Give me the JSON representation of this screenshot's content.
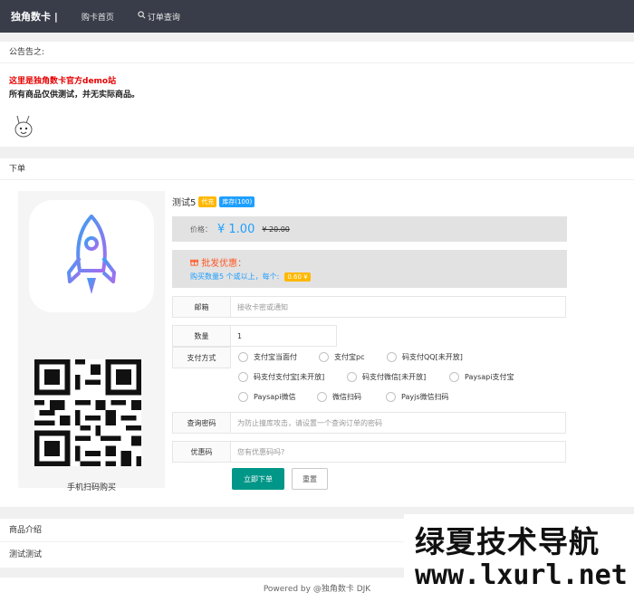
{
  "nav": {
    "brand": "独角数卡 |",
    "items": [
      {
        "label": "购卡首页"
      },
      {
        "label": "订单查询",
        "icon": "search-icon"
      }
    ]
  },
  "notice": {
    "title": "公告告之:",
    "line1": "这里是独角数卡官方demo站",
    "line2": "所有商品仅供测试，并无实际商品。"
  },
  "order": {
    "title": "下单",
    "product_name": "测试5",
    "badge_auto": "代充",
    "badge_stock": "库存(100)",
    "price_label": "价格：",
    "price_now": "¥ 1.00",
    "price_old": "¥ 20.00",
    "bulk_title": "批发优惠：",
    "bulk_desc": "购买数量5 个或以上，每个:",
    "bulk_price": "0.60 ¥",
    "email_label": "邮箱",
    "email_placeholder": "接收卡密或通知",
    "qty_label": "数量",
    "qty_value": "1",
    "pay_label": "支付方式",
    "pay_options": [
      "支付宝当面付",
      "支付宝pc",
      "码支付QQ[未开放]",
      "码支付支付宝[未开放]",
      "码支付微信[未开放]",
      "Paysapi支付宝",
      "Paysapi微信",
      "微信扫码",
      "Payjs微信扫码"
    ],
    "query_label": "查询密码",
    "query_placeholder": "为防止撞库攻击，请设置一个查询订单的密码",
    "coupon_label": "优惠码",
    "coupon_placeholder": "您有优惠码吗?",
    "submit_label": "立即下单",
    "reset_label": "重置",
    "scan_label": "手机扫码购买"
  },
  "intro": {
    "title": "商品介绍",
    "content": "测试测试"
  },
  "footer": {
    "text": "Powered by @独角数卡 DJK"
  },
  "watermark": {
    "line1": "绿夏技术导航",
    "line2": "www.lxurl.net"
  },
  "colors": {
    "topbar": "#393d49",
    "accent_blue": "#1e9fff",
    "accent_green": "#009688",
    "accent_orange": "#ffb800",
    "notice_red": "#e60000"
  }
}
